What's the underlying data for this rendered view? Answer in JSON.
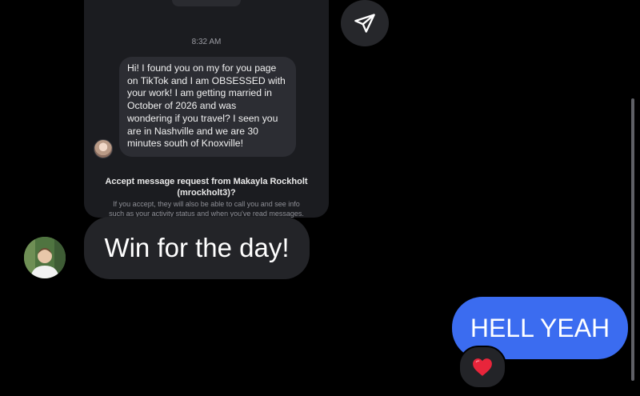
{
  "shared_post": {
    "timestamp": "8:32 AM",
    "message_lines": [
      "Hi! I found you on my for you page",
      "on TikTok and I am OBSESSED with",
      "your work! I am getting married in",
      "October of 2026 and was",
      "wondering if you travel? I seen you",
      "are in Nashville and we are 30",
      "minutes south of Knoxville!"
    ],
    "request_title_line1": "Accept message request from Makayla Rockholt",
    "request_title_line2": "(mrockholt3)?",
    "request_sub_line1": "If you accept, they will also be able to call you and see info",
    "request_sub_line2": "such as your activity status and when you've read messages."
  },
  "conversation": {
    "received_message": "Win for the day!",
    "sent_message": "HELL YEAH",
    "reaction_emoji": "❤️"
  },
  "icons": {
    "share": "paper-plane-icon",
    "avatar": "profile-photo"
  },
  "colors": {
    "background": "#000000",
    "sent_bubble": "#3b6cf0",
    "received_bubble": "#232428",
    "heart": "#e8253b"
  }
}
